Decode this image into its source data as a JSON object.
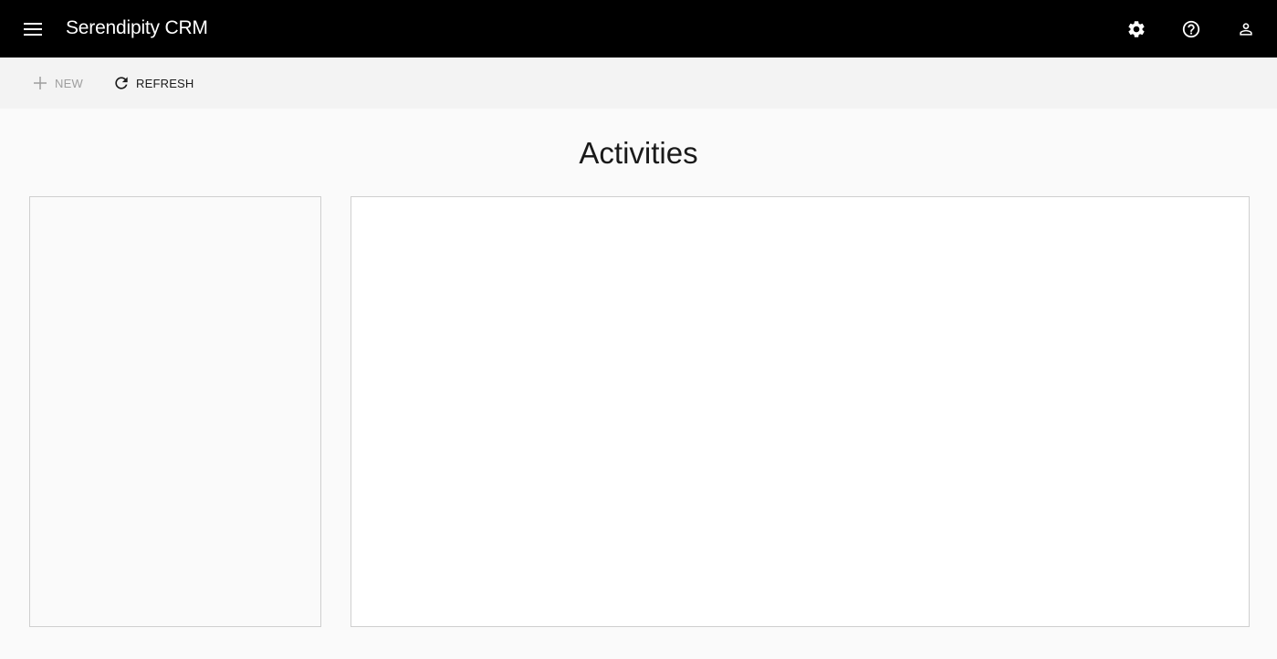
{
  "header": {
    "title": "Serendipity CRM",
    "icons": {
      "menu": "hamburger-menu-icon",
      "settings": "gear-icon",
      "help": "help-circle-icon",
      "account": "person-icon"
    },
    "background": "#000000",
    "text_color": "#ffffff"
  },
  "toolbar": {
    "new_label": "NEW",
    "refresh_label": "REFRESH",
    "new_enabled": false,
    "icons": {
      "new": "plus-icon",
      "refresh": "refresh-icon"
    }
  },
  "main": {
    "title": "Activities"
  }
}
